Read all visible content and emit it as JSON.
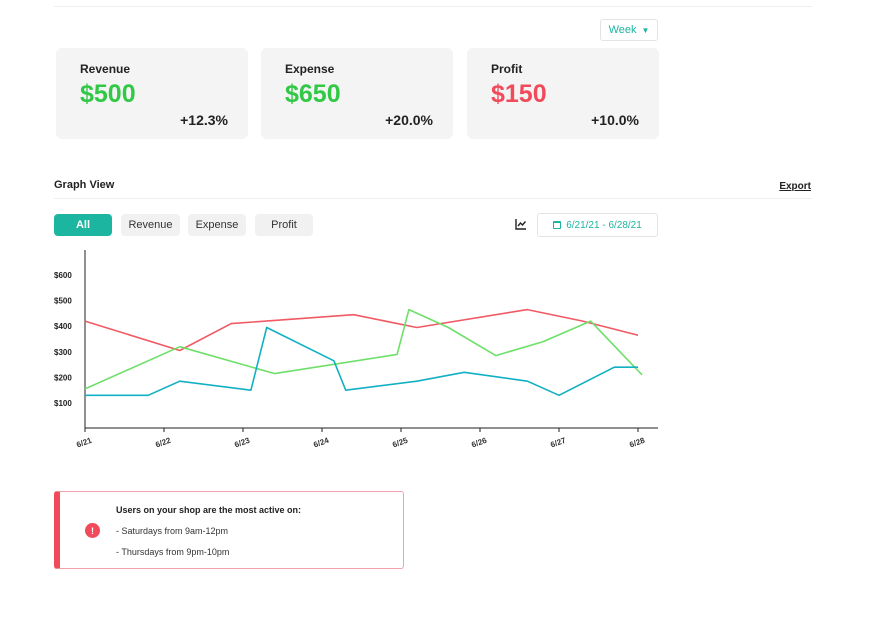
{
  "header": {
    "period_select": {
      "value": "Week",
      "caret": "▼"
    }
  },
  "stats": {
    "revenue": {
      "label": "Revenue",
      "amount": "$500",
      "change": "+12.3%",
      "color": "#31c846"
    },
    "expense": {
      "label": "Expense",
      "amount": "$650",
      "change": "+20.0%",
      "color": "#31c846"
    },
    "profit": {
      "label": "Profit",
      "amount": "$150",
      "change": "+10.0%",
      "color": "#f14b5b"
    }
  },
  "graph_view": {
    "title": "Graph View",
    "export_label": "Export",
    "tabs": [
      "All",
      "Revenue",
      "Expense",
      "Profit"
    ],
    "active_tab": "All",
    "chart_type_icon": "line-chart-icon",
    "date_range": "6/21/21 - 6/28/21",
    "calendar_icon": "calendar-icon"
  },
  "chart_data": {
    "type": "line",
    "title": "",
    "xlabel": "",
    "ylabel": "",
    "ylim": [
      0,
      650
    ],
    "yticks": [
      "$100",
      "$200",
      "$300",
      "$400",
      "$500",
      "$600"
    ],
    "xticks": [
      "6/21",
      "6/22",
      "6/23",
      "6/24",
      "6/25",
      "6/26",
      "6/27",
      "6/28"
    ],
    "grid": false,
    "legend": "none",
    "series": [
      {
        "color": "#f05a64",
        "points": [
          [
            0,
            420
          ],
          [
            1.2,
            305
          ],
          [
            1.85,
            410
          ],
          [
            3.4,
            445
          ],
          [
            4.2,
            395
          ],
          [
            5.6,
            465
          ],
          [
            6.3,
            420
          ],
          [
            7.0,
            365
          ]
        ]
      },
      {
        "color": "#6ee06a",
        "points": [
          [
            0,
            155
          ],
          [
            1.2,
            320
          ],
          [
            2.4,
            215
          ],
          [
            3.95,
            290
          ],
          [
            4.1,
            465
          ],
          [
            4.6,
            395
          ],
          [
            5.2,
            285
          ],
          [
            5.8,
            340
          ],
          [
            6.4,
            420
          ],
          [
            7.05,
            210
          ]
        ]
      },
      {
        "color": "#12b0c4",
        "points": [
          [
            0,
            130
          ],
          [
            0.8,
            130
          ],
          [
            1.2,
            185
          ],
          [
            2.1,
            150
          ],
          [
            2.3,
            395
          ],
          [
            3.15,
            265
          ],
          [
            3.3,
            150
          ],
          [
            4.2,
            185
          ],
          [
            4.8,
            220
          ],
          [
            5.6,
            185
          ],
          [
            6.0,
            130
          ],
          [
            6.7,
            240
          ],
          [
            7.0,
            240
          ]
        ]
      }
    ]
  },
  "insight": {
    "alert_symbol": "!",
    "title": "Users on your shop are the most active on:",
    "lines": [
      "- Saturdays from 9am-12pm",
      "- Thursdays from 9pm-10pm"
    ]
  }
}
